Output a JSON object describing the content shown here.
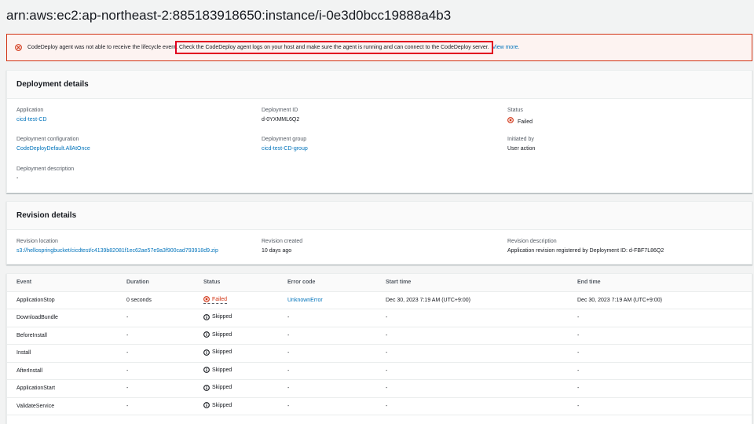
{
  "page_title": "arn:aws:ec2:ap-northeast-2:885183918650:instance/i-0e3d0bcc19888a4b3",
  "alert": {
    "message_prefix": "CodeDeploy agent was not able to receive the lifecycle event.",
    "message_highlight": "Check the CodeDeploy agent logs on your host and make sure the agent is running and can connect to the CodeDeploy server.",
    "link": "View more."
  },
  "deployment_details": {
    "header": "Deployment details",
    "application_label": "Application",
    "application_value": "cicd-test-CD",
    "deployment_id_label": "Deployment ID",
    "deployment_id_value": "d-0YXMML6Q2",
    "status_label": "Status",
    "status_value": "Failed",
    "config_label": "Deployment configuration",
    "config_value": "CodeDeployDefault.AllAtOnce",
    "group_label": "Deployment group",
    "group_value": "cicd-test-CD-group",
    "initiated_label": "Initiated by",
    "initiated_value": "User action",
    "description_label": "Deployment description",
    "description_value": "-"
  },
  "revision_details": {
    "header": "Revision details",
    "location_label": "Revision location",
    "location_value": "s3://hellospringbucket/cicdtest/c4139b82081f1ec62ae57e9a3f900cad793918d9.zip",
    "created_label": "Revision created",
    "created_value": "10 days ago",
    "description_label": "Revision description",
    "description_value": "Application revision registered by Deployment ID: d-FBF7L86Q2"
  },
  "events_table": {
    "columns": [
      "Event",
      "Duration",
      "Status",
      "Error code",
      "Start time",
      "End time"
    ],
    "rows": [
      {
        "event": "ApplicationStop",
        "duration": "0 seconds",
        "status": "Failed",
        "error": "UnknownError",
        "start": "Dec 30, 2023 7:19 AM (UTC+9:00)",
        "end": "Dec 30, 2023 7:19 AM (UTC+9:00)"
      },
      {
        "event": "DownloadBundle",
        "duration": "-",
        "status": "Skipped",
        "error": "-",
        "start": "-",
        "end": "-"
      },
      {
        "event": "BeforeInstall",
        "duration": "-",
        "status": "Skipped",
        "error": "-",
        "start": "-",
        "end": "-"
      },
      {
        "event": "Install",
        "duration": "-",
        "status": "Skipped",
        "error": "-",
        "start": "-",
        "end": "-"
      },
      {
        "event": "AfterInstall",
        "duration": "-",
        "status": "Skipped",
        "error": "-",
        "start": "-",
        "end": "-"
      },
      {
        "event": "ApplicationStart",
        "duration": "-",
        "status": "Skipped",
        "error": "-",
        "start": "-",
        "end": "-"
      },
      {
        "event": "ValidateService",
        "duration": "-",
        "status": "Skipped",
        "error": "-",
        "start": "-",
        "end": "-"
      }
    ]
  },
  "colors": {
    "error": "#d13212",
    "link": "#0073bb",
    "highlight_box": "#e1001f"
  }
}
